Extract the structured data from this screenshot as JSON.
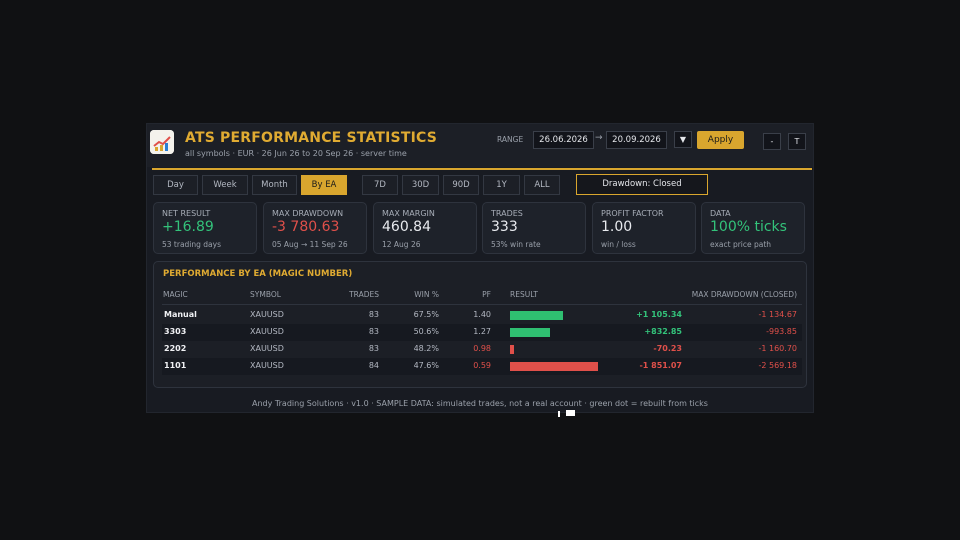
{
  "header": {
    "title": "ATS PERFORMANCE STATISTICS",
    "subtitle": "all symbols · EUR · 26 Jun 26 to 20 Sep 26 · server time",
    "range_label": "RANGE",
    "date_from": "26.06.2026",
    "date_arrow": "→",
    "date_to": "20.09.2026",
    "dropdown_glyph": "▼",
    "apply_label": "Apply",
    "minimize_label": "-",
    "topmost_label": "T"
  },
  "tabs": {
    "day": "Day",
    "week": "Week",
    "month": "Month",
    "by_ea": "By EA",
    "d7": "7D",
    "d30": "30D",
    "d90": "90D",
    "y1": "1Y",
    "all": "ALL",
    "active": "By EA",
    "drawdown_mode": "Drawdown: Closed"
  },
  "cards": [
    {
      "label": "NET RESULT",
      "value": "+16.89",
      "sub": "53 trading days",
      "tone": "green"
    },
    {
      "label": "MAX DRAWDOWN",
      "value": "-3 780.63",
      "sub": "05 Aug → 11 Sep 26",
      "tone": "red"
    },
    {
      "label": "MAX MARGIN",
      "value": "460.84",
      "sub": "12 Aug 26",
      "tone": "neutral"
    },
    {
      "label": "TRADES",
      "value": "333",
      "sub": "53% win rate",
      "tone": "neutral"
    },
    {
      "label": "PROFIT FACTOR",
      "value": "1.00",
      "sub": "win / loss",
      "tone": "neutral"
    },
    {
      "label": "DATA",
      "value": "100% ticks",
      "sub": "exact price path",
      "tone": "green"
    }
  ],
  "table": {
    "title": "PERFORMANCE BY EA (MAGIC NUMBER)",
    "columns": {
      "magic": "MAGIC",
      "symbol": "SYMBOL",
      "trades": "TRADES",
      "win": "WIN %",
      "pf": "PF",
      "result": "RESULT",
      "dd": "MAX DRAWDOWN (CLOSED)"
    },
    "rows": [
      {
        "magic": "Manual",
        "symbol": "XAUUSD",
        "trades": "83",
        "win": "67.5%",
        "pf": "1.40",
        "pf_tone": "neutral",
        "bar_fraction": 0.6,
        "bar_color": "#2fbf71",
        "result": "+1 105.34",
        "result_tone": "green",
        "dd": "-1 134.67"
      },
      {
        "magic": "3303",
        "symbol": "XAUUSD",
        "trades": "83",
        "win": "50.6%",
        "pf": "1.27",
        "pf_tone": "neutral",
        "bar_fraction": 0.45,
        "bar_color": "#2fbf71",
        "result": "+832.85",
        "result_tone": "green",
        "dd": "-993.85"
      },
      {
        "magic": "2202",
        "symbol": "XAUUSD",
        "trades": "83",
        "win": "48.2%",
        "pf": "0.98",
        "pf_tone": "red",
        "bar_fraction": 0.04,
        "bar_color": "#e0504a",
        "result": "-70.23",
        "result_tone": "red",
        "dd": "-1 160.70"
      },
      {
        "magic": "1101",
        "symbol": "XAUUSD",
        "trades": "84",
        "win": "47.6%",
        "pf": "0.59",
        "pf_tone": "red",
        "bar_fraction": 1.0,
        "bar_color": "#e0504a",
        "result": "-1 851.07",
        "result_tone": "red",
        "dd": "-2 569.18"
      }
    ]
  },
  "footer": "Andy Trading Solutions · v1.0 · SAMPLE DATA: simulated trades, not a real account · green dot = rebuilt from ticks",
  "colors": {
    "accent": "#d9a62e",
    "green": "#33c27a",
    "red": "#e0504a"
  }
}
